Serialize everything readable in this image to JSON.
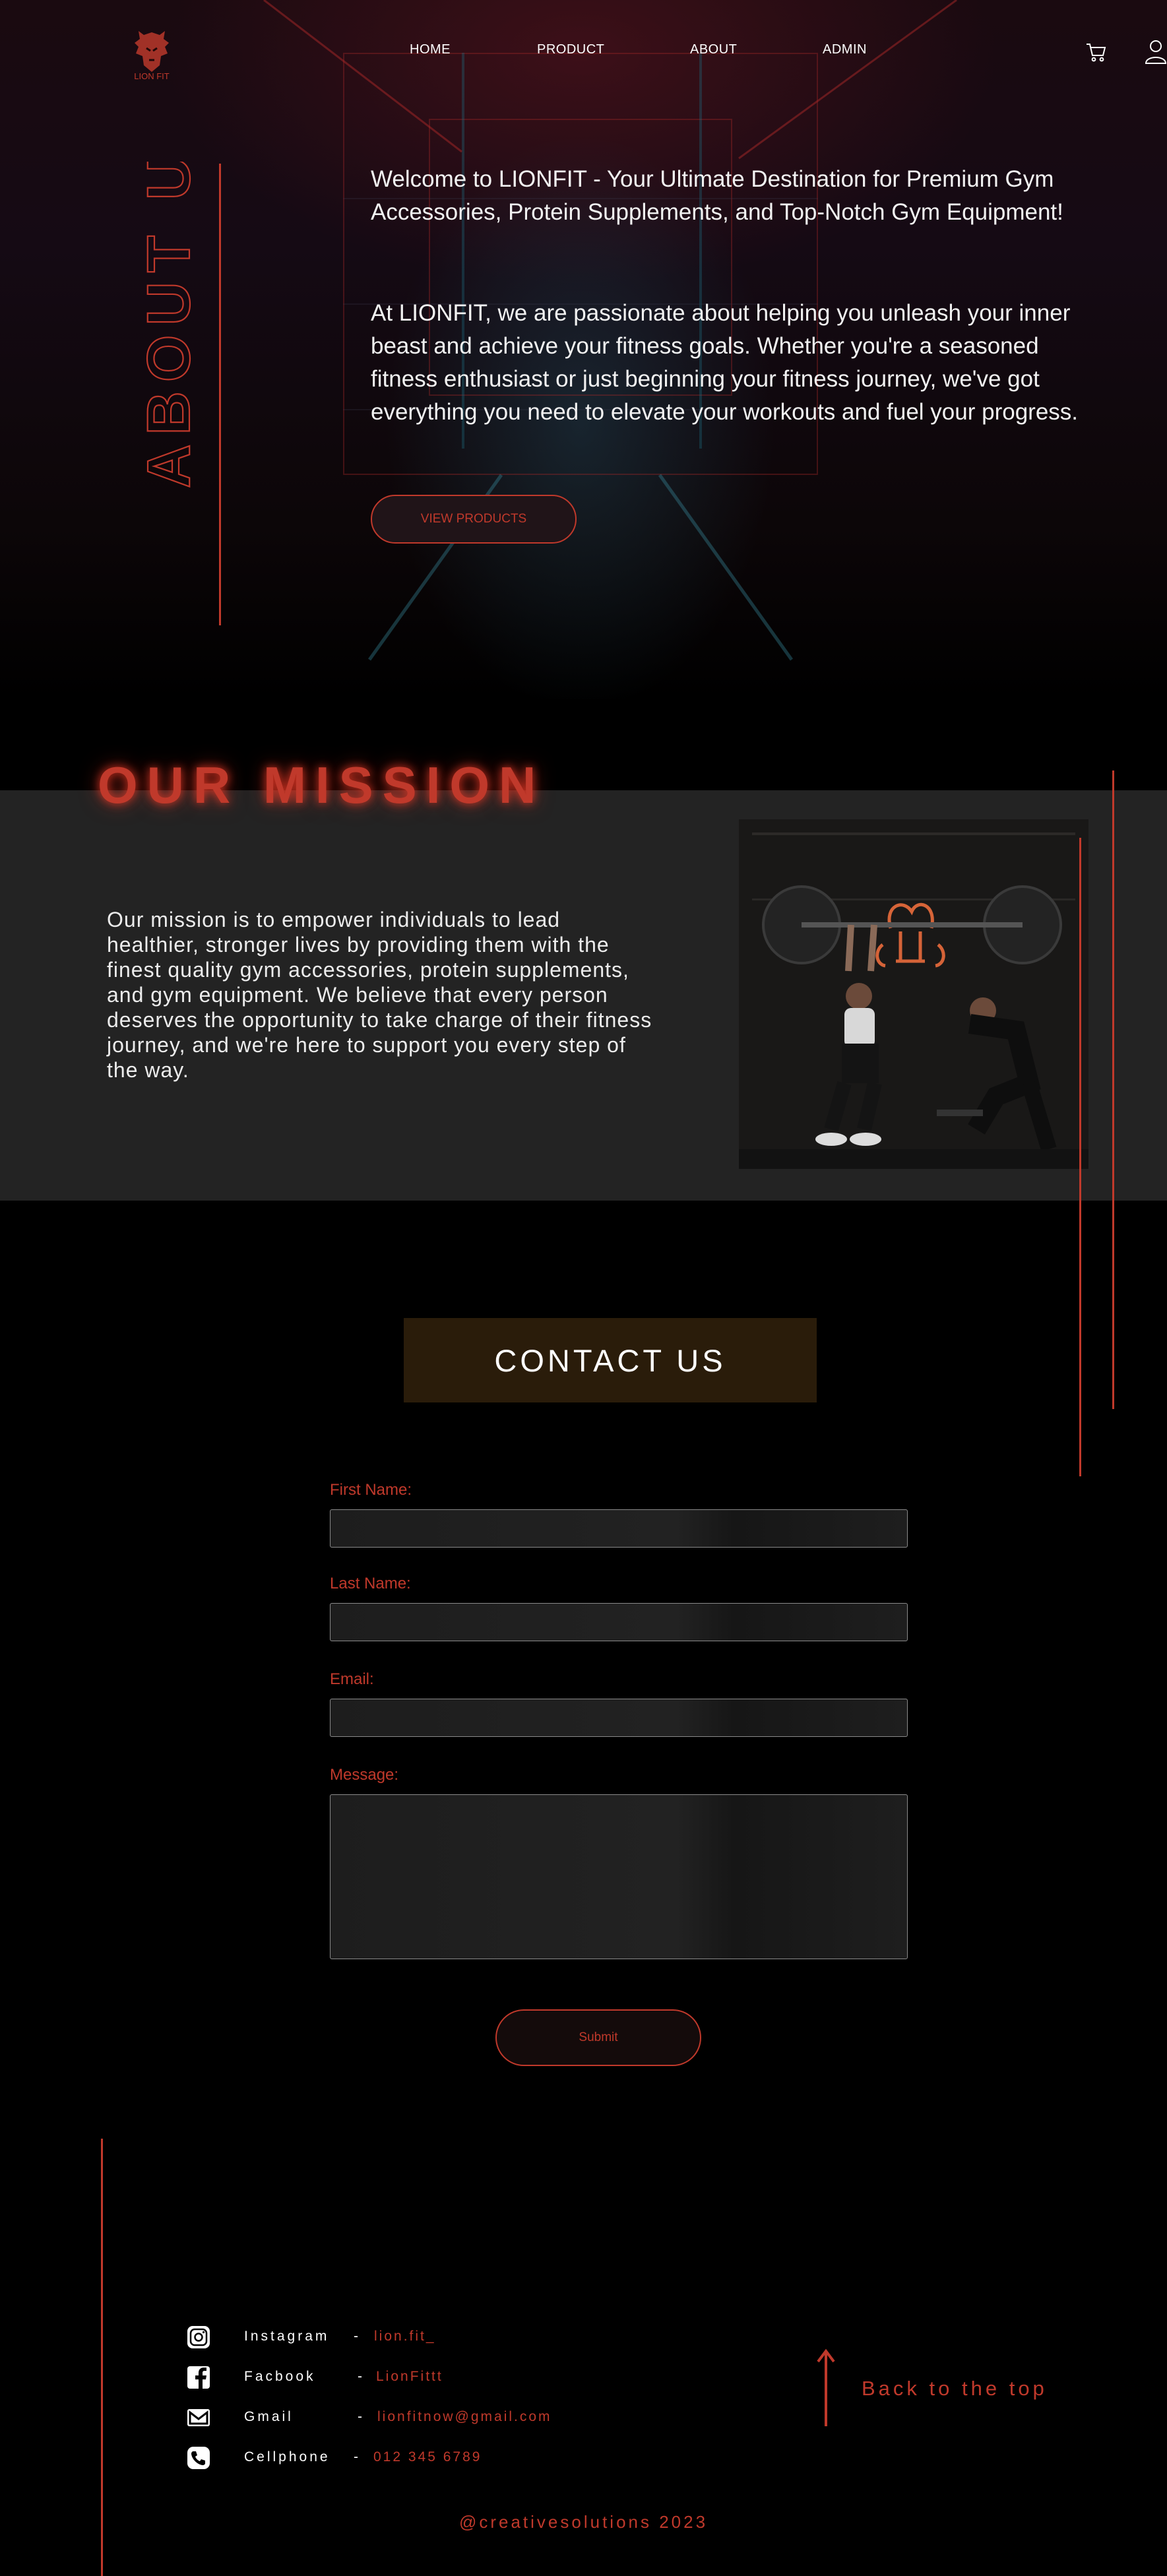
{
  "brand": {
    "logo_text": "LION FIT",
    "accent_color": "#c0392b"
  },
  "nav": {
    "items": [
      "HOME",
      "PRODUCT",
      "ABOUT",
      "ADMIN"
    ],
    "cart_icon": "cart-icon",
    "user_icon": "user-icon"
  },
  "about": {
    "vertical_title": "ABOUT US",
    "intro": "Welcome to LIONFIT - Your Ultimate Destination for Premium Gym Accessories, Protein Supplements, and Top-Notch Gym Equipment!",
    "body": "At LIONFIT, we are passionate about helping you unleash your inner beast and achieve your fitness goals. Whether you're a seasoned fitness enthusiast or just beginning your fitness journey, we've got everything you need to elevate your workouts and fuel your progress.",
    "button_label": "VIEW PRODUCTS"
  },
  "mission": {
    "title": "OUR MISSION",
    "text": "Our mission is to empower individuals to lead healthier, stronger lives by providing them with the finest quality gym accessories, protein supplements, and gym equipment. We believe that every person deserves the opportunity to take charge of their fitness journey, and we're here to support you every step of the way."
  },
  "contact": {
    "title": "CONTACT US",
    "first_name_label": "First Name:",
    "last_name_label": "Last Name:",
    "email_label": "Email:",
    "message_label": "Message:",
    "submit_label": "Submit"
  },
  "footer": {
    "socials": [
      {
        "icon": "instagram-icon",
        "label": "Instagram",
        "value": "lion.fit_"
      },
      {
        "icon": "facebook-icon",
        "label": "Facbook",
        "value": "LionFittt"
      },
      {
        "icon": "gmail-icon",
        "label": "Gmail",
        "value": "lionfitnow@gmail.com"
      },
      {
        "icon": "phone-icon",
        "label": "Cellphone",
        "value": "012 345 6789"
      }
    ],
    "separator": "-",
    "back_to_top": "Back to the top",
    "copyright": "@creativesolutions 2023"
  }
}
